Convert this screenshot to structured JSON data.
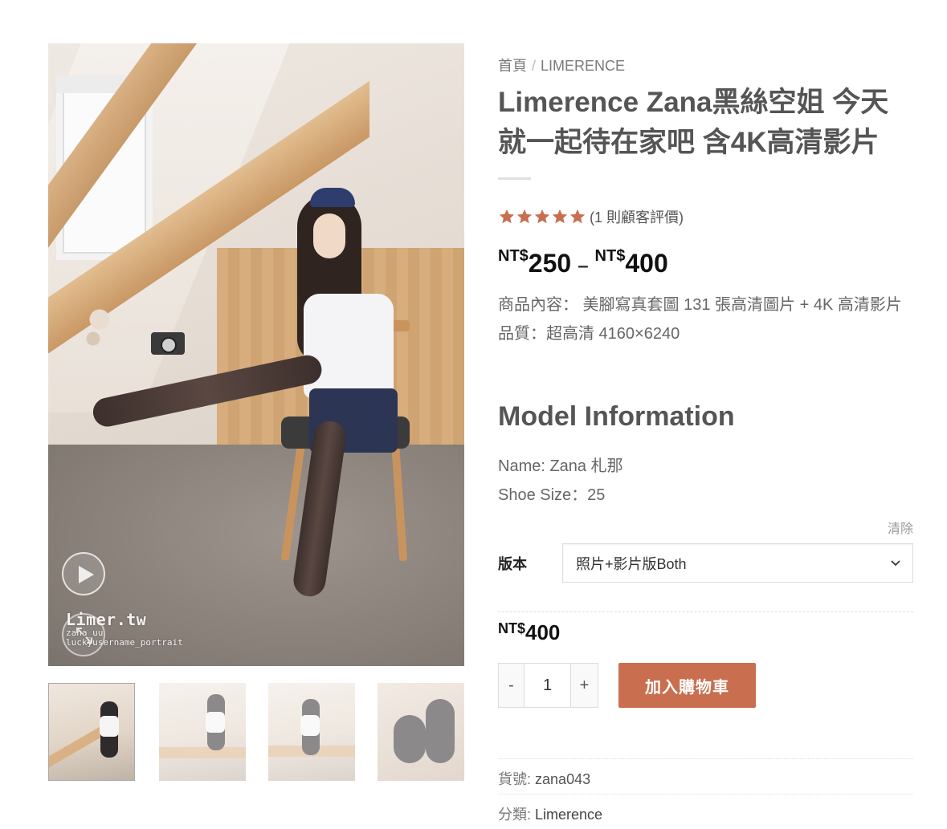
{
  "gallery": {
    "watermark": {
      "title": "Limer.tw",
      "line1": "zana_uu",
      "line2": "luckyusername_portrait"
    },
    "icons": {
      "play": "play-icon",
      "zoom": "expand-icon"
    }
  },
  "breadcrumb": {
    "home": "首頁",
    "separator": "/",
    "category": "LIMERENCE"
  },
  "product": {
    "title": "Limerence Zana黑絲空姐 今天就一起待在家吧 含4K高清影片",
    "rating": {
      "stars": 5,
      "max": 5,
      "reviews_text": "(1 則顧客評價)"
    },
    "price_range": {
      "min_currency": "NT$",
      "min_amount": "250",
      "dash": "–",
      "max_currency": "NT$",
      "max_amount": "400"
    },
    "description": {
      "line1": "商品內容： 美腳寫真套圖 131 張高清圖片 + 4K 高清影片",
      "line2": "品質：超高清 4160×6240"
    }
  },
  "model": {
    "heading": "Model Information",
    "name": "Name: Zana 札那",
    "shoe_size": "Shoe Size：25"
  },
  "variation": {
    "reset_label": "清除",
    "label": "版本",
    "selected": "照片+影片版Both",
    "price_currency": "NT$",
    "price_amount": "400"
  },
  "cart": {
    "minus": "-",
    "quantity": "1",
    "plus": "+",
    "add_label": "加入購物車"
  },
  "meta": {
    "sku_label": "貨號:",
    "sku": "zana043",
    "category_label": "分類:",
    "category": "Limerence"
  },
  "colors": {
    "accent": "#c96e4e",
    "star": "#c96e4e"
  }
}
